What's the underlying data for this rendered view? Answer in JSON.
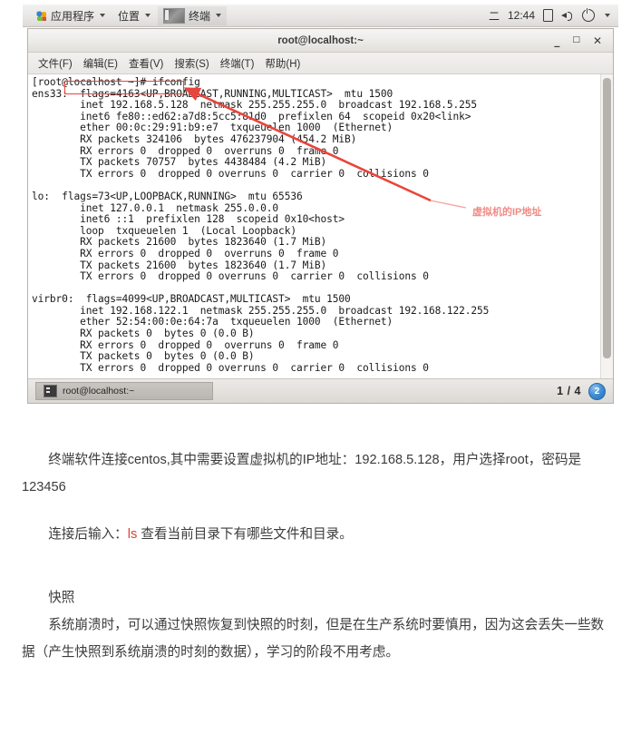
{
  "desktop": {
    "panel": {
      "applications_label": "应用程序",
      "places_label": "位置",
      "terminal_label": "终端",
      "clock_day": "二",
      "clock_time": "12:44",
      "icons": [
        "battery-icon",
        "volume-icon",
        "power-icon",
        "chevron-down-icon"
      ]
    }
  },
  "terminal": {
    "title": "root@localhost:~",
    "window_buttons": {
      "minimize": "_",
      "maximize": "□",
      "close": "✕"
    },
    "menus": [
      "文件(F)",
      "编辑(E)",
      "查看(V)",
      "搜索(S)",
      "终端(T)",
      "帮助(H)"
    ],
    "output_lines": [
      "[root@localhost ~]# ifconfig",
      "ens33:  flags=4163<UP,BROADCAST,RUNNING,MULTICAST>  mtu 1500",
      "        inet 192.168.5.128  netmask 255.255.255.0  broadcast 192.168.5.255",
      "        inet6 fe80::ed62:a7d8:5cc5:81d0  prefixlen 64  scopeid 0x20<link>",
      "        ether 00:0c:29:91:b9:e7  txqueuelen 1000  (Ethernet)",
      "        RX packets 324106  bytes 476237904 (454.2 MiB)",
      "        RX errors 0  dropped 0  overruns 0  frame 0",
      "        TX packets 70757  bytes 4438484 (4.2 MiB)",
      "        TX errors 0  dropped 0 overruns 0  carrier 0  collisions 0",
      "",
      "lo:  flags=73<UP,LOOPBACK,RUNNING>  mtu 65536",
      "        inet 127.0.0.1  netmask 255.0.0.0",
      "        inet6 ::1  prefixlen 128  scopeid 0x10<host>",
      "        loop  txqueuelen 1  (Local Loopback)",
      "        RX packets 21600  bytes 1823640 (1.7 MiB)",
      "        RX errors 0  dropped 0  overruns 0  frame 0",
      "        TX packets 21600  bytes 1823640 (1.7 MiB)",
      "        TX errors 0  dropped 0 overruns 0  carrier 0  collisions 0",
      "",
      "virbr0:  flags=4099<UP,BROADCAST,MULTICAST>  mtu 1500",
      "        inet 192.168.122.1  netmask 255.255.255.0  broadcast 192.168.122.255",
      "        ether 52:54:00:0e:64:7a  txqueuelen 1000  (Ethernet)",
      "        RX packets 0  bytes 0 (0.0 B)",
      "        RX errors 0  dropped 0  overruns 0  frame 0",
      "        TX packets 0  bytes 0 (0.0 B)",
      "        TX errors 0  dropped 0 overruns 0  carrier 0  collisions 0"
    ],
    "statusbar": {
      "task_label": "root@localhost:~",
      "page_indicator": "1 / 4",
      "badge": "2"
    }
  },
  "annotation": {
    "label": "虚拟机的IP地址",
    "accent_color": "#e8453c",
    "label_color": "#f08b86",
    "highlighted_value": "inet 192.168.5.128"
  },
  "document": {
    "paragraph1": "终端软件连接centos,其中需要设置虚拟机的IP地址：192.168.5.128，用户选择root，密码是123456",
    "paragraph2_prefix": "连接后输入：",
    "paragraph2_command": "ls",
    "paragraph2_suffix": " 查看当前目录下有哪些文件和目录。",
    "heading_snapshot": "快照",
    "paragraph3": "系统崩溃时，可以通过快照恢复到快照的时刻，但是在生产系统时要慎用，因为这会丢失一些数据（产生快照到系统崩溃的时刻的数据），学习的阶段不用考虑。"
  }
}
